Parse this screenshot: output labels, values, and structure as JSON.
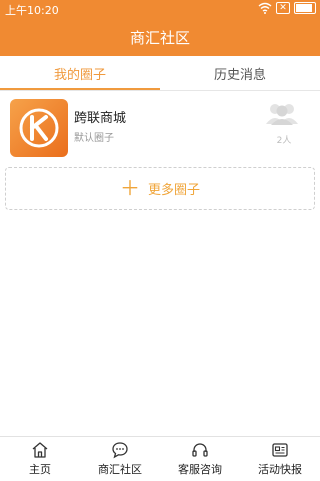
{
  "status_bar": {
    "time": "上午10:20",
    "x_label": "✕"
  },
  "header": {
    "title": "商汇社区"
  },
  "tabs": [
    {
      "label": "我的圈子",
      "active": true
    },
    {
      "label": "历史消息",
      "active": false
    }
  ],
  "circle": {
    "name": "跨联商城",
    "subtitle": "默认圈子",
    "members": "2人"
  },
  "more_button": {
    "label": "更多圈子"
  },
  "bottom_nav": [
    {
      "label": "主页",
      "icon": "home-icon"
    },
    {
      "label": "商汇社区",
      "icon": "chat-icon"
    },
    {
      "label": "客服咨询",
      "icon": "headset-icon"
    },
    {
      "label": "活动快报",
      "icon": "news-icon"
    }
  ],
  "colors": {
    "accent": "#f08a32",
    "tab_active": "#f09a3e"
  }
}
